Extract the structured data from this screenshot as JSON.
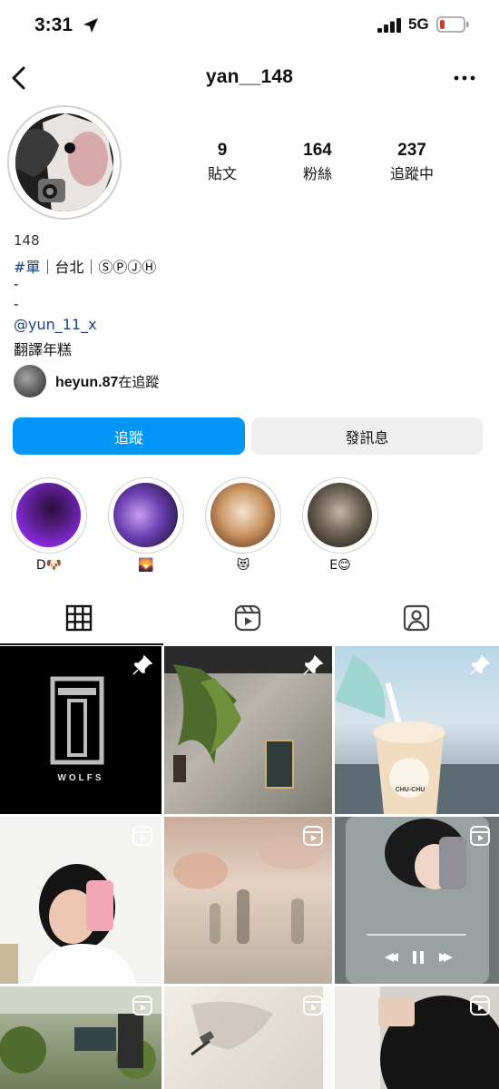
{
  "status_bar": {
    "time": "3:31",
    "network": "5G"
  },
  "header": {
    "username": "yan__148"
  },
  "stats": [
    {
      "value": "9",
      "label": "貼文"
    },
    {
      "value": "164",
      "label": "粉絲"
    },
    {
      "value": "237",
      "label": "追蹤中"
    }
  ],
  "bio": {
    "name": "148",
    "hashtag": "#單",
    "line2_rest": "｜台北｜ⓈⓅⒿⒽ",
    "line3": "-",
    "line4": "-",
    "mention": "@yun_11_x",
    "line6": "翻譯年糕"
  },
  "followed_by": {
    "user": "heyun.87",
    "suffix": "在追蹤"
  },
  "buttons": {
    "follow": "追蹤",
    "message": "發訊息"
  },
  "highlights": [
    {
      "label": "D🐶"
    },
    {
      "label": "🌄"
    },
    {
      "label": "😻"
    },
    {
      "label": "E😊"
    }
  ],
  "grid_tiles": {
    "wolfs_text": "WOLFS",
    "cup_text": "CHU-CHU"
  },
  "colors": {
    "accent": "#0095f6",
    "secondary_button": "#efefef",
    "link": "#1f3f77"
  }
}
